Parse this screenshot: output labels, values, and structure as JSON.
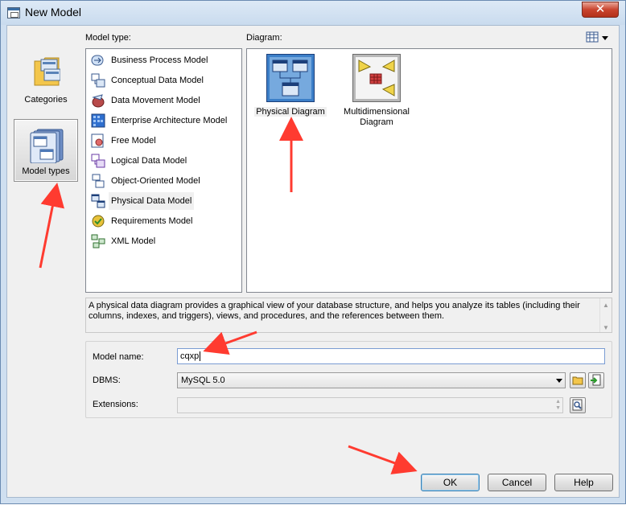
{
  "window": {
    "title": "New Model",
    "close_glyph": "✕"
  },
  "categories": [
    {
      "label": "Categories",
      "icon": "folder-icon",
      "selected": false
    },
    {
      "label": "Model types",
      "icon": "model-types-icon",
      "selected": true
    }
  ],
  "model_type": {
    "label": "Model type:",
    "items": [
      {
        "label": "Business Process Model",
        "icon": "business-process-icon"
      },
      {
        "label": "Conceptual Data Model",
        "icon": "conceptual-data-icon"
      },
      {
        "label": "Data Movement Model",
        "icon": "data-movement-icon"
      },
      {
        "label": "Enterprise Architecture Model",
        "icon": "enterprise-architecture-icon"
      },
      {
        "label": "Free Model",
        "icon": "free-model-icon"
      },
      {
        "label": "Logical Data Model",
        "icon": "logical-data-icon"
      },
      {
        "label": "Object-Oriented Model",
        "icon": "object-oriented-icon"
      },
      {
        "label": "Physical Data Model",
        "icon": "physical-data-icon",
        "selected": true
      },
      {
        "label": "Requirements Model",
        "icon": "requirements-icon"
      },
      {
        "label": "XML Model",
        "icon": "xml-model-icon"
      }
    ]
  },
  "diagram": {
    "label": "Diagram:",
    "items": [
      {
        "label": "Physical Diagram",
        "icon": "physical-diagram-icon",
        "selected": true
      },
      {
        "label_line1": "Multidimensional",
        "label_line2": "Diagram",
        "icon": "multidimensional-diagram-icon"
      }
    ]
  },
  "description": "A physical data diagram provides a graphical view of your database structure, and helps you analyze its tables (including their columns, indexes, and triggers), views, and procedures, and the references between them.",
  "form": {
    "model_name_label": "Model name:",
    "model_name_value": "cqxp",
    "dbms_label": "DBMS:",
    "dbms_value": "MySQL 5.0",
    "extensions_label": "Extensions:",
    "extensions_value": ""
  },
  "buttons": {
    "ok": "OK",
    "cancel": "Cancel",
    "help": "Help"
  },
  "colors": {
    "annotation_arrow": "#ff3b30",
    "selection": "#3a6ea5"
  }
}
